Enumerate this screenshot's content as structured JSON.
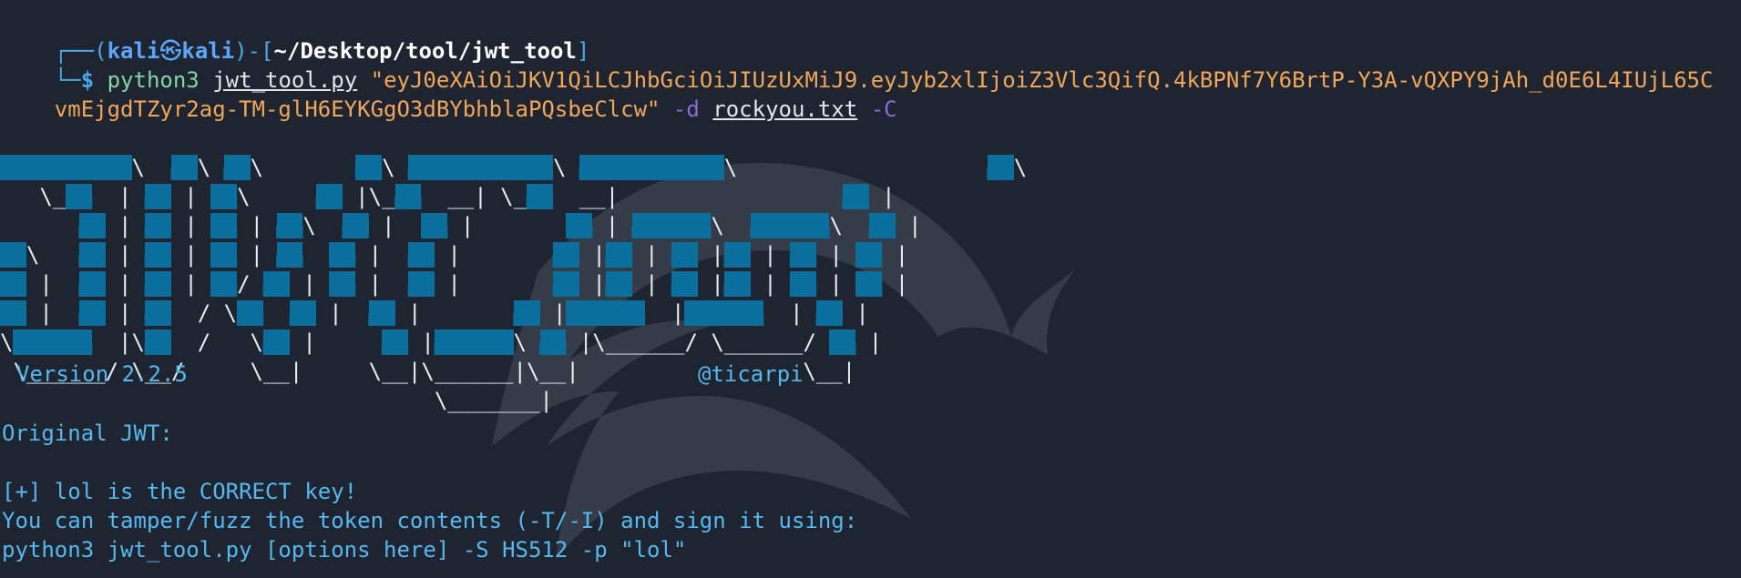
{
  "prompt": {
    "box_left": "┌──(",
    "user": "kali",
    "at_icon": "㉿",
    "host": "kali",
    "box_right": ")-[",
    "path": "~/Desktop/tool/jwt_tool",
    "box_close": "]",
    "line2_prefix": "└─",
    "dollar": "$"
  },
  "command": {
    "program": "python3",
    "script": "jwt_tool.py",
    "token_part1": "\"eyJ0eXAiOiJKV1QiLCJhbGciOiJIUzUxMiJ9.eyJyb2xlIjoiZ3Vlc3QifQ.4kBPNf7Y6BrtP-Y3A-vQXPY9jAh_d0E6L4IUjL65C",
    "token_part2": "vmEjgdTZyr2ag-TM-glH6EYKGgO3dBYbhblaPQsbeClcw\"",
    "dict_flag": "-d",
    "dict_file": "rockyou.txt",
    "crack_flag": "-C"
  },
  "banner": {
    "version": "Version 2.2.5",
    "author": "@ticarpi"
  },
  "output": {
    "original_jwt_label": "Original JWT:",
    "success": "[+] lol is the CORRECT key!",
    "hint": "You can tamper/fuzz the token contents (-T/-I) and sign it using:",
    "sign_command": "python3 jwt_tool.py [options here] -S HS512 -p \"lol\""
  },
  "colors": {
    "background": "#1f2530",
    "prompt": "#4aa7e8",
    "command": "#7fd7a3",
    "string": "#f2a65a",
    "flag": "#8c6ad8",
    "banner_fill": "#0a6f9d",
    "success": "#69d39b"
  }
}
